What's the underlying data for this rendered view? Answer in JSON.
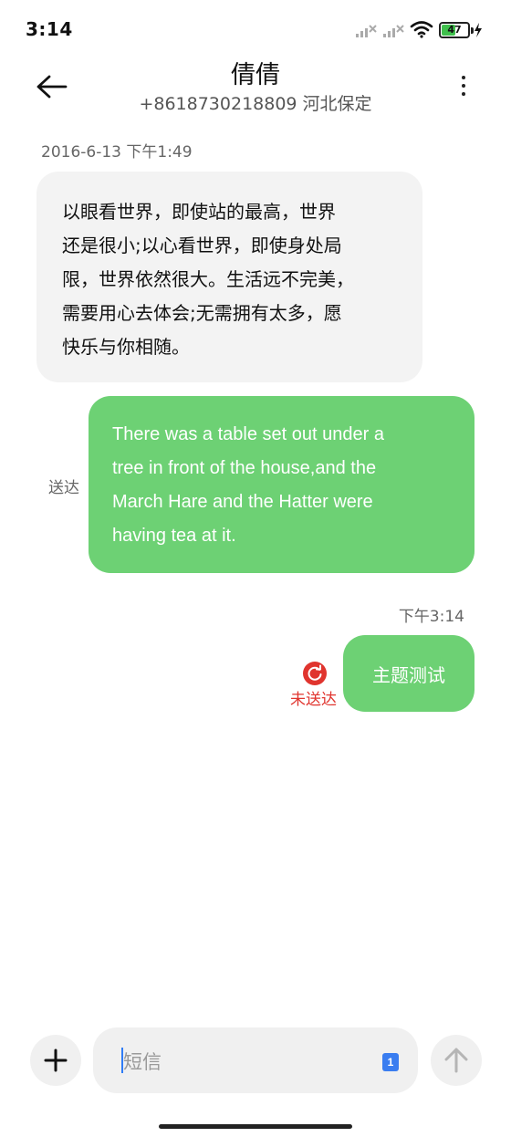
{
  "status_bar": {
    "time": "3:14",
    "battery_level": "47",
    "icons": [
      "signal-1-icon",
      "signal-2-icon",
      "wifi-icon",
      "battery-icon",
      "charging-icon"
    ]
  },
  "header": {
    "contact_name": "倩倩",
    "contact_detail": "+8618730218809 河北保定",
    "back_icon": "arrow-left-icon",
    "more_icon": "more-vertical-icon"
  },
  "messages": {
    "date_label": "2016-6-13 下午1:49",
    "received_text": "以眼看世界，即使站的最高，世界还是很小;以心看世界，即使身处局限，世界依然很大。生活远不完美，需要用心去体会;无需拥有太多，愿快乐与你相随。",
    "received_lines": [
      "以眼看世界，即使站的最高，世界",
      "还是很小;以心看世界，即使身处局",
      "限，世界依然很大。生活远不完美，",
      "需要用心去体会;无需拥有太多，愿",
      "快乐与你相随。"
    ],
    "sent_1_lines": [
      "There was a table set out under a",
      "tree in front of the house,and the",
      "March Hare and the Hatter were",
      "having tea at it."
    ],
    "sent_1_status": "送达",
    "time_label": "下午3:14",
    "sent_2_text": "主题测试",
    "sent_2_status": "未送达"
  },
  "composer": {
    "placeholder": "短信",
    "sim_badge": "1",
    "add_icon": "plus-icon",
    "send_icon": "arrow-up-icon"
  },
  "colors": {
    "sent_bubble": "#6dd174",
    "received_bubble": "#f3f3f3",
    "error": "#e0342e",
    "accent": "#3a7df0"
  }
}
